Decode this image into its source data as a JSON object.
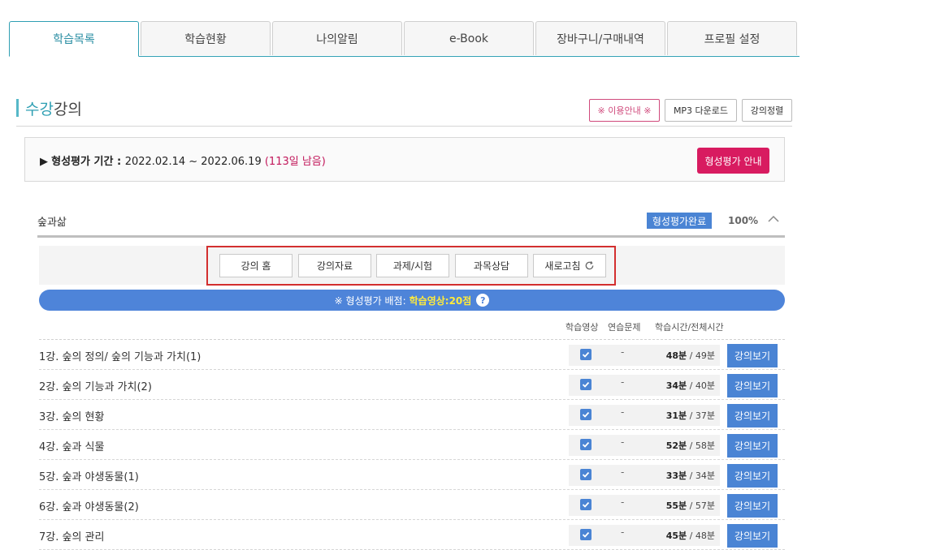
{
  "tabs": [
    "학습목록",
    "학습현황",
    "나의알림",
    "e-Book",
    "장바구니/구매내역",
    "프로필 설정"
  ],
  "section": {
    "title_accent": "수강",
    "title_rest": "강의"
  },
  "top_buttons": {
    "guide": "※ 이용안내 ※",
    "mp3": "MP3 다운로드",
    "sort": "강의정렬"
  },
  "period": {
    "label": "형성평가 기간 : ",
    "range": "2022.02.14 ~ 2022.06.19",
    "remain": "(113일 남음)",
    "button": "형성평가 안내"
  },
  "course": {
    "name": "숲과삶",
    "badge": "형성평가완료",
    "percent": "100%",
    "progress": 1.0
  },
  "menu": [
    "강의 홈",
    "강의자료",
    "과제/시험",
    "과목상담",
    "새로고침"
  ],
  "score": {
    "label": "※ 형성평가 배점:",
    "value": "학습영상:20점",
    "help": "?"
  },
  "columns": {
    "video": "학습영상",
    "practice": "연습문제",
    "time": "학습시간/전체시간"
  },
  "lectures": [
    {
      "title": "1강. 숲의 정의/ 숲의 기능과 가치(1)",
      "practice": "-",
      "studied": "48분",
      "total": "49분",
      "watch": "강의보기"
    },
    {
      "title": "2강. 숲의 기능과 가치(2)",
      "practice": "-",
      "studied": "34분",
      "total": "40분",
      "watch": "강의보기"
    },
    {
      "title": "3강. 숲의 현황",
      "practice": "-",
      "studied": "31분",
      "total": "37분",
      "watch": "강의보기"
    },
    {
      "title": "4강. 숲과 식물",
      "practice": "-",
      "studied": "52분",
      "total": "58분",
      "watch": "강의보기"
    },
    {
      "title": "5강. 숲과 야생동물(1)",
      "practice": "-",
      "studied": "33분",
      "total": "34분",
      "watch": "강의보기"
    },
    {
      "title": "6강. 숲과 야생동물(2)",
      "practice": "-",
      "studied": "55분",
      "total": "57분",
      "watch": "강의보기"
    },
    {
      "title": "7강. 숲의 관리",
      "practice": "-",
      "studied": "45분",
      "total": "48분",
      "watch": "강의보기"
    }
  ],
  "colors": {
    "accent": "#2f9fb3",
    "pink": "#d81b60",
    "blue": "#4a84d4"
  },
  "icons": {
    "refresh": "refresh-icon",
    "chevron": "chevron-up-icon",
    "check": "check-icon"
  }
}
